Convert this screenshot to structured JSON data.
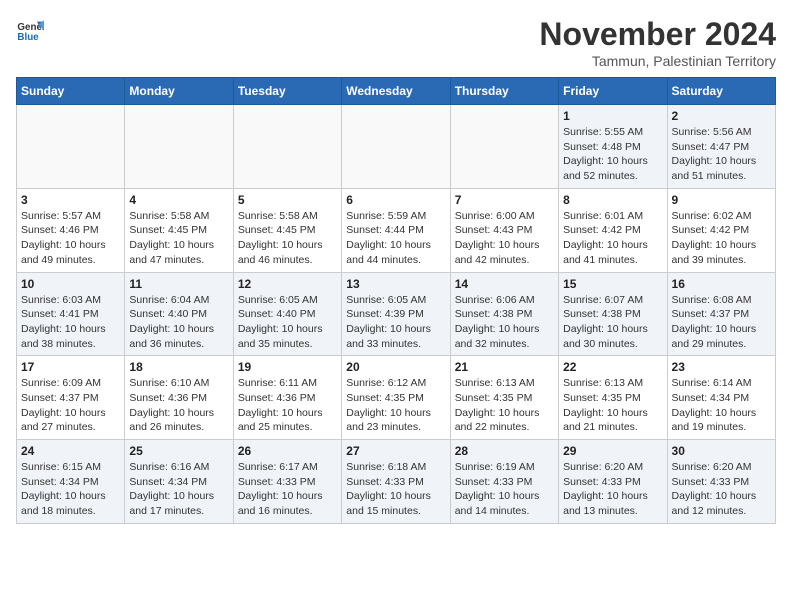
{
  "header": {
    "logo_general": "General",
    "logo_blue": "Blue",
    "month": "November 2024",
    "location": "Tammun, Palestinian Territory"
  },
  "weekdays": [
    "Sunday",
    "Monday",
    "Tuesday",
    "Wednesday",
    "Thursday",
    "Friday",
    "Saturday"
  ],
  "weeks": [
    [
      {
        "day": "",
        "info": ""
      },
      {
        "day": "",
        "info": ""
      },
      {
        "day": "",
        "info": ""
      },
      {
        "day": "",
        "info": ""
      },
      {
        "day": "",
        "info": ""
      },
      {
        "day": "1",
        "info": "Sunrise: 5:55 AM\nSunset: 4:48 PM\nDaylight: 10 hours\nand 52 minutes."
      },
      {
        "day": "2",
        "info": "Sunrise: 5:56 AM\nSunset: 4:47 PM\nDaylight: 10 hours\nand 51 minutes."
      }
    ],
    [
      {
        "day": "3",
        "info": "Sunrise: 5:57 AM\nSunset: 4:46 PM\nDaylight: 10 hours\nand 49 minutes."
      },
      {
        "day": "4",
        "info": "Sunrise: 5:58 AM\nSunset: 4:45 PM\nDaylight: 10 hours\nand 47 minutes."
      },
      {
        "day": "5",
        "info": "Sunrise: 5:58 AM\nSunset: 4:45 PM\nDaylight: 10 hours\nand 46 minutes."
      },
      {
        "day": "6",
        "info": "Sunrise: 5:59 AM\nSunset: 4:44 PM\nDaylight: 10 hours\nand 44 minutes."
      },
      {
        "day": "7",
        "info": "Sunrise: 6:00 AM\nSunset: 4:43 PM\nDaylight: 10 hours\nand 42 minutes."
      },
      {
        "day": "8",
        "info": "Sunrise: 6:01 AM\nSunset: 4:42 PM\nDaylight: 10 hours\nand 41 minutes."
      },
      {
        "day": "9",
        "info": "Sunrise: 6:02 AM\nSunset: 4:42 PM\nDaylight: 10 hours\nand 39 minutes."
      }
    ],
    [
      {
        "day": "10",
        "info": "Sunrise: 6:03 AM\nSunset: 4:41 PM\nDaylight: 10 hours\nand 38 minutes."
      },
      {
        "day": "11",
        "info": "Sunrise: 6:04 AM\nSunset: 4:40 PM\nDaylight: 10 hours\nand 36 minutes."
      },
      {
        "day": "12",
        "info": "Sunrise: 6:05 AM\nSunset: 4:40 PM\nDaylight: 10 hours\nand 35 minutes."
      },
      {
        "day": "13",
        "info": "Sunrise: 6:05 AM\nSunset: 4:39 PM\nDaylight: 10 hours\nand 33 minutes."
      },
      {
        "day": "14",
        "info": "Sunrise: 6:06 AM\nSunset: 4:38 PM\nDaylight: 10 hours\nand 32 minutes."
      },
      {
        "day": "15",
        "info": "Sunrise: 6:07 AM\nSunset: 4:38 PM\nDaylight: 10 hours\nand 30 minutes."
      },
      {
        "day": "16",
        "info": "Sunrise: 6:08 AM\nSunset: 4:37 PM\nDaylight: 10 hours\nand 29 minutes."
      }
    ],
    [
      {
        "day": "17",
        "info": "Sunrise: 6:09 AM\nSunset: 4:37 PM\nDaylight: 10 hours\nand 27 minutes."
      },
      {
        "day": "18",
        "info": "Sunrise: 6:10 AM\nSunset: 4:36 PM\nDaylight: 10 hours\nand 26 minutes."
      },
      {
        "day": "19",
        "info": "Sunrise: 6:11 AM\nSunset: 4:36 PM\nDaylight: 10 hours\nand 25 minutes."
      },
      {
        "day": "20",
        "info": "Sunrise: 6:12 AM\nSunset: 4:35 PM\nDaylight: 10 hours\nand 23 minutes."
      },
      {
        "day": "21",
        "info": "Sunrise: 6:13 AM\nSunset: 4:35 PM\nDaylight: 10 hours\nand 22 minutes."
      },
      {
        "day": "22",
        "info": "Sunrise: 6:13 AM\nSunset: 4:35 PM\nDaylight: 10 hours\nand 21 minutes."
      },
      {
        "day": "23",
        "info": "Sunrise: 6:14 AM\nSunset: 4:34 PM\nDaylight: 10 hours\nand 19 minutes."
      }
    ],
    [
      {
        "day": "24",
        "info": "Sunrise: 6:15 AM\nSunset: 4:34 PM\nDaylight: 10 hours\nand 18 minutes."
      },
      {
        "day": "25",
        "info": "Sunrise: 6:16 AM\nSunset: 4:34 PM\nDaylight: 10 hours\nand 17 minutes."
      },
      {
        "day": "26",
        "info": "Sunrise: 6:17 AM\nSunset: 4:33 PM\nDaylight: 10 hours\nand 16 minutes."
      },
      {
        "day": "27",
        "info": "Sunrise: 6:18 AM\nSunset: 4:33 PM\nDaylight: 10 hours\nand 15 minutes."
      },
      {
        "day": "28",
        "info": "Sunrise: 6:19 AM\nSunset: 4:33 PM\nDaylight: 10 hours\nand 14 minutes."
      },
      {
        "day": "29",
        "info": "Sunrise: 6:20 AM\nSunset: 4:33 PM\nDaylight: 10 hours\nand 13 minutes."
      },
      {
        "day": "30",
        "info": "Sunrise: 6:20 AM\nSunset: 4:33 PM\nDaylight: 10 hours\nand 12 minutes."
      }
    ]
  ]
}
